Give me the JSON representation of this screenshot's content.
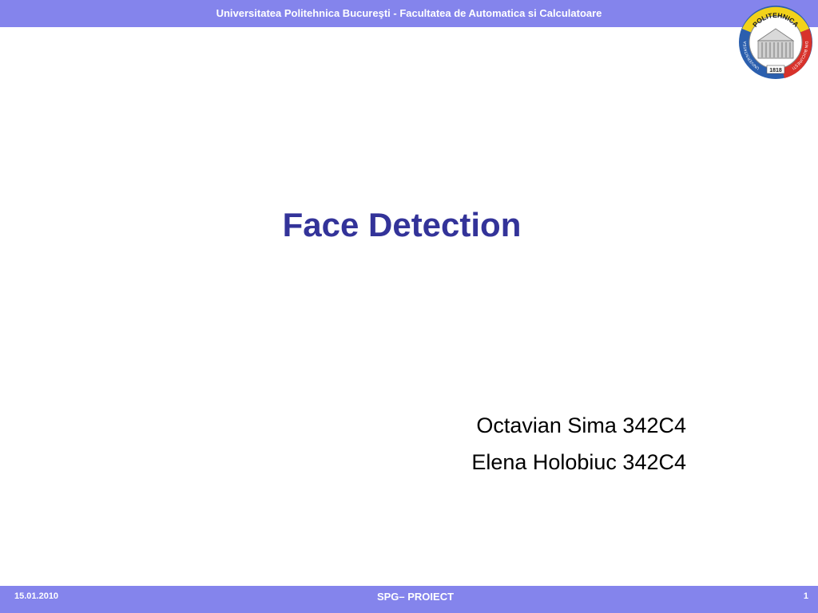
{
  "header": {
    "text": "Universitatea Politehnica Bucureşti - Facultatea de Automatica si Calculatoare"
  },
  "logo": {
    "text_top": "POLITEHNICA",
    "text_left": "UNIVERSITATEA",
    "text_right": "DIN BUCUREŞTI",
    "year": "1818",
    "colors": {
      "yellow": "#f2d21a",
      "blue": "#2b5fae",
      "red": "#d8322b",
      "building": "#cfcfcf"
    }
  },
  "slide": {
    "title": "Face Detection",
    "authors": [
      "Octavian Sima 342C4",
      "Elena Holobiuc 342C4"
    ]
  },
  "footer": {
    "date": "15.01.2010",
    "center": "SPG– PROIECT",
    "page_number": "1"
  },
  "colors": {
    "bar": "#8484ec",
    "title": "#333399",
    "bar_text": "#ffffff"
  }
}
